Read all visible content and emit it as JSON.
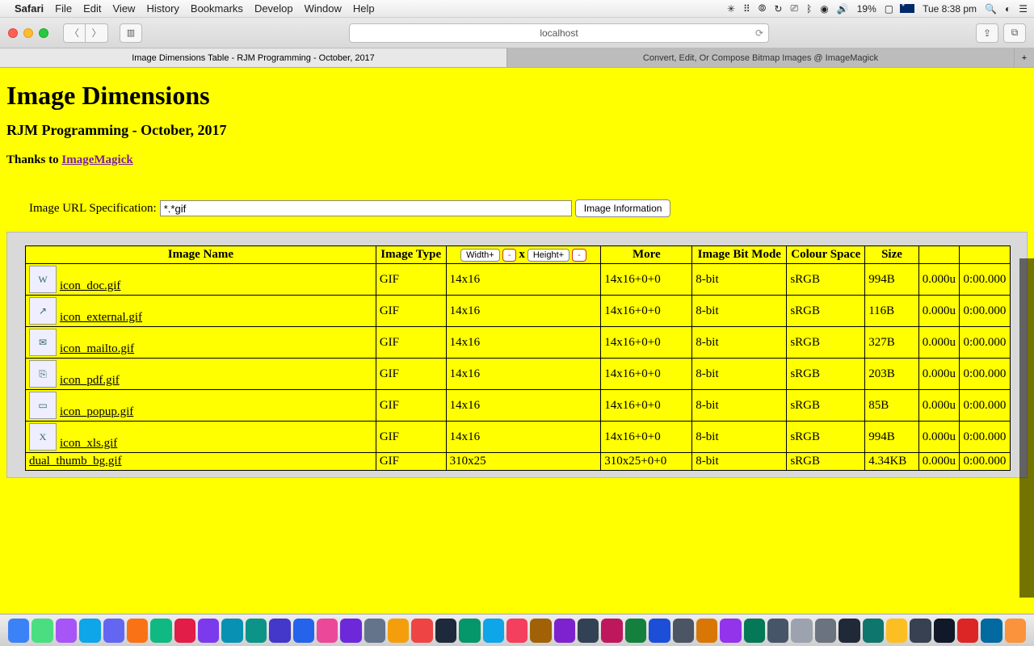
{
  "menubar": {
    "app": "Safari",
    "items": [
      "File",
      "Edit",
      "View",
      "History",
      "Bookmarks",
      "Develop",
      "Window",
      "Help"
    ],
    "battery": "19%",
    "clock": "Tue 8:38 pm"
  },
  "toolbar": {
    "address": "localhost"
  },
  "tabs": {
    "active": "Image Dimensions Table - RJM Programming - October, 2017",
    "inactive": "Convert, Edit, Or Compose Bitmap Images @ ImageMagick"
  },
  "page": {
    "title": "Image Dimensions",
    "subtitle": "RJM Programming - October, 2017",
    "thanks_prefix": "Thanks to ",
    "thanks_link": "ImageMagick",
    "form": {
      "label": "Image URL Specification:",
      "value": "*.*gif",
      "button": "Image Information"
    },
    "headers": {
      "name": "Image Name",
      "type": "Image Type",
      "width_btn": "Width+",
      "minus1": "-",
      "x": "x",
      "height_btn": "Height+",
      "minus2": "-",
      "more": "More",
      "bitmode": "Image Bit Mode",
      "colourspace": "Colour Space",
      "size": "Size"
    },
    "rows": [
      {
        "thumb": "W",
        "name": "icon_doc.gif",
        "type": "GIF",
        "dim": "14x16",
        "more": "14x16+0+0",
        "bit": "8-bit",
        "cs": "sRGB",
        "size": "994B",
        "u": "0.000u",
        "t": "0:00.000"
      },
      {
        "thumb": "↗",
        "name": "icon_external.gif",
        "type": "GIF",
        "dim": "14x16",
        "more": "14x16+0+0",
        "bit": "8-bit",
        "cs": "sRGB",
        "size": "116B",
        "u": "0.000u",
        "t": "0:00.000"
      },
      {
        "thumb": "✉",
        "name": "icon_mailto.gif",
        "type": "GIF",
        "dim": "14x16",
        "more": "14x16+0+0",
        "bit": "8-bit",
        "cs": "sRGB",
        "size": "327B",
        "u": "0.000u",
        "t": "0:00.000"
      },
      {
        "thumb": "⎘",
        "name": "icon_pdf.gif",
        "type": "GIF",
        "dim": "14x16",
        "more": "14x16+0+0",
        "bit": "8-bit",
        "cs": "sRGB",
        "size": "203B",
        "u": "0.000u",
        "t": "0:00.000"
      },
      {
        "thumb": "▭",
        "name": "icon_popup.gif",
        "type": "GIF",
        "dim": "14x16",
        "more": "14x16+0+0",
        "bit": "8-bit",
        "cs": "sRGB",
        "size": "85B",
        "u": "0.000u",
        "t": "0:00.000"
      },
      {
        "thumb": "X",
        "name": "icon_xls.gif",
        "type": "GIF",
        "dim": "14x16",
        "more": "14x16+0+0",
        "bit": "8-bit",
        "cs": "sRGB",
        "size": "994B",
        "u": "0.000u",
        "t": "0:00.000"
      },
      {
        "thumb": "",
        "name": "dual_thumb_bg.gif",
        "type": "GIF",
        "dim": "310x25",
        "more": "310x25+0+0",
        "bit": "8-bit",
        "cs": "sRGB",
        "size": "4.34KB",
        "u": "0.000u",
        "t": "0:00.000"
      }
    ]
  },
  "dock_colors": [
    "#3b82f6",
    "#4ade80",
    "#a855f7",
    "#0ea5e9",
    "#6366f1",
    "#f97316",
    "#10b981",
    "#e11d48",
    "#7c3aed",
    "#0891b2",
    "#0d9488",
    "#4338ca",
    "#2563eb",
    "#ec4899",
    "#6d28d9",
    "#64748b",
    "#f59e0b",
    "#ef4444",
    "#1e293b",
    "#059669",
    "#0ea5e9",
    "#f43f5e",
    "#a16207",
    "#7e22ce",
    "#334155",
    "#be185d",
    "#15803d",
    "#1d4ed8",
    "#4b5563",
    "#d97706",
    "#9333ea",
    "#047857",
    "#475569",
    "#9ca3af",
    "#6b7280",
    "#1f2937",
    "#0f766e",
    "#fbbf24",
    "#374151",
    "#111827",
    "#dc2626",
    "#0369a1",
    "#fb923c"
  ]
}
